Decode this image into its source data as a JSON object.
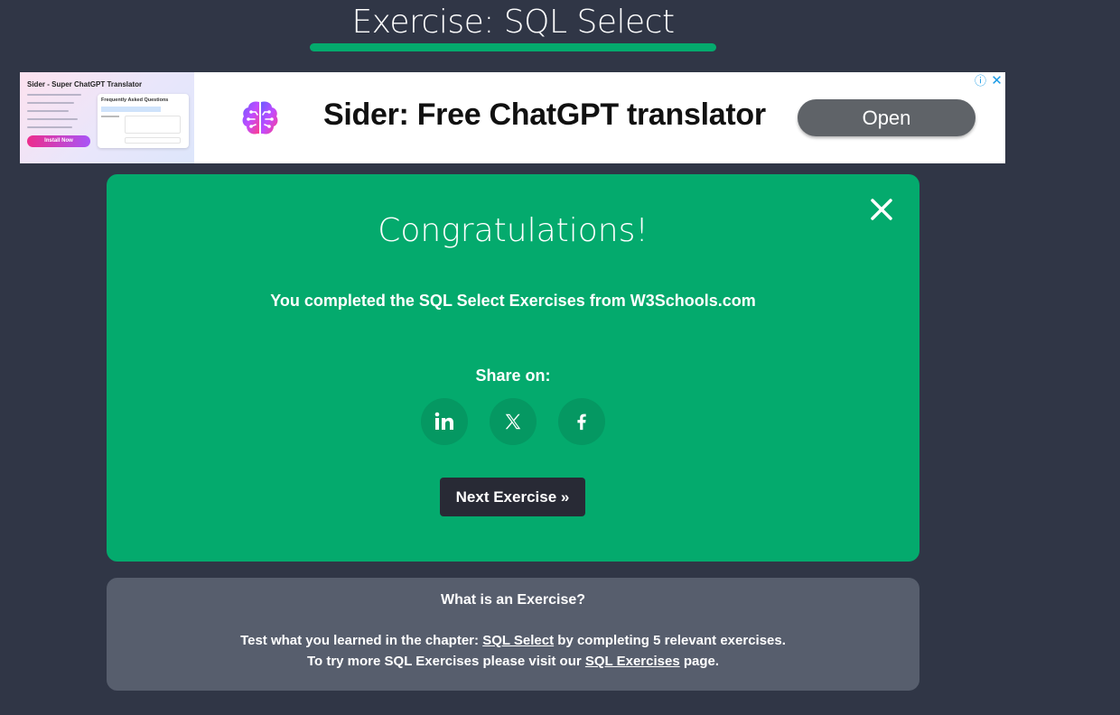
{
  "page": {
    "title": "Exercise: SQL Select"
  },
  "ad": {
    "thumb_title": "Sider - Super ChatGPT Translator",
    "thumb_card_title": "Frequently Asked Questions",
    "thumb_button": "Install Now",
    "headline": "Sider: Free ChatGPT translator",
    "open_label": "Open",
    "info_icon": "info-icon",
    "close_icon": "close-icon"
  },
  "card": {
    "heading": "Congratulations!",
    "message": "You completed the SQL Select Exercises from W3Schools.com",
    "share_label": "Share on:",
    "social": [
      "linkedin-icon",
      "x-icon",
      "facebook-icon"
    ],
    "next_label": "Next Exercise »"
  },
  "info": {
    "title": "What is an Exercise?",
    "line1_prefix": "Test what you learned in the chapter: ",
    "line1_link": "SQL Select",
    "line1_suffix": " by completing 5 relevant exercises.",
    "line2_prefix": "To try more SQL Exercises please visit our ",
    "line2_link": "SQL Exercises",
    "line2_suffix": " page."
  },
  "colors": {
    "background": "#303646",
    "accent": "#04aa6d",
    "social_circle": "#059862",
    "button_dark": "#282a35",
    "info_box": "#575e6d"
  }
}
